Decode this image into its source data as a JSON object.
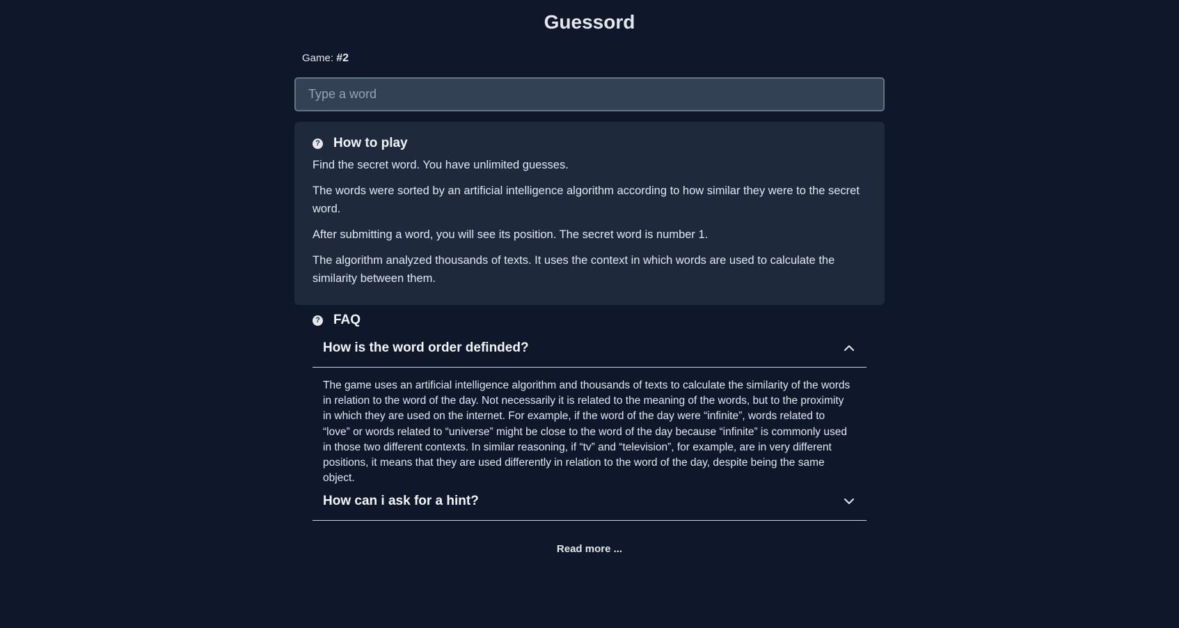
{
  "header": {
    "title": "Guessord"
  },
  "game": {
    "label": "Game:",
    "number": "#2"
  },
  "input": {
    "placeholder": "Type a word"
  },
  "how_to_play": {
    "title": "How to play",
    "paragraphs": [
      "Find the secret word. You have unlimited guesses.",
      "The words were sorted by an artificial intelligence algorithm according to how similar they were to the secret word.",
      "After submitting a word, you will see its position. The secret word is number 1.",
      "The algorithm analyzed thousands of texts. It uses the context in which words are used to calculate the similarity between them."
    ]
  },
  "faq": {
    "title": "FAQ",
    "items": [
      {
        "question": "How is the word order definded?",
        "expanded": true,
        "answer": "The game uses an artificial intelligence algorithm and thousands of texts to calculate the similarity of the words in relation to the word of the day. Not necessarily it is related to the meaning of the words, but to the proximity in which they are used on the internet. For example, if the word of the day were “infinite”, words related to “love” or words related to “universe” might be close to the word of the day because “infinite” is commonly used in those two different contexts. In similar reasoning, if “tv” and “television”, for example, are in very different positions, it means that they are used differently in relation to the word of the day, despite being the same object."
      },
      {
        "question": "How can i ask for a hint?",
        "expanded": false
      }
    ]
  },
  "read_more": "Read more ...",
  "icons": {
    "help": "question-circle-icon",
    "expanded": "chevron-up-icon",
    "collapsed": "chevron-down-icon"
  },
  "colors": {
    "background": "#0f172a",
    "panel": "#1e293b",
    "input_bg": "#334155",
    "input_border": "#64748b",
    "text": "#e2e8f0"
  }
}
